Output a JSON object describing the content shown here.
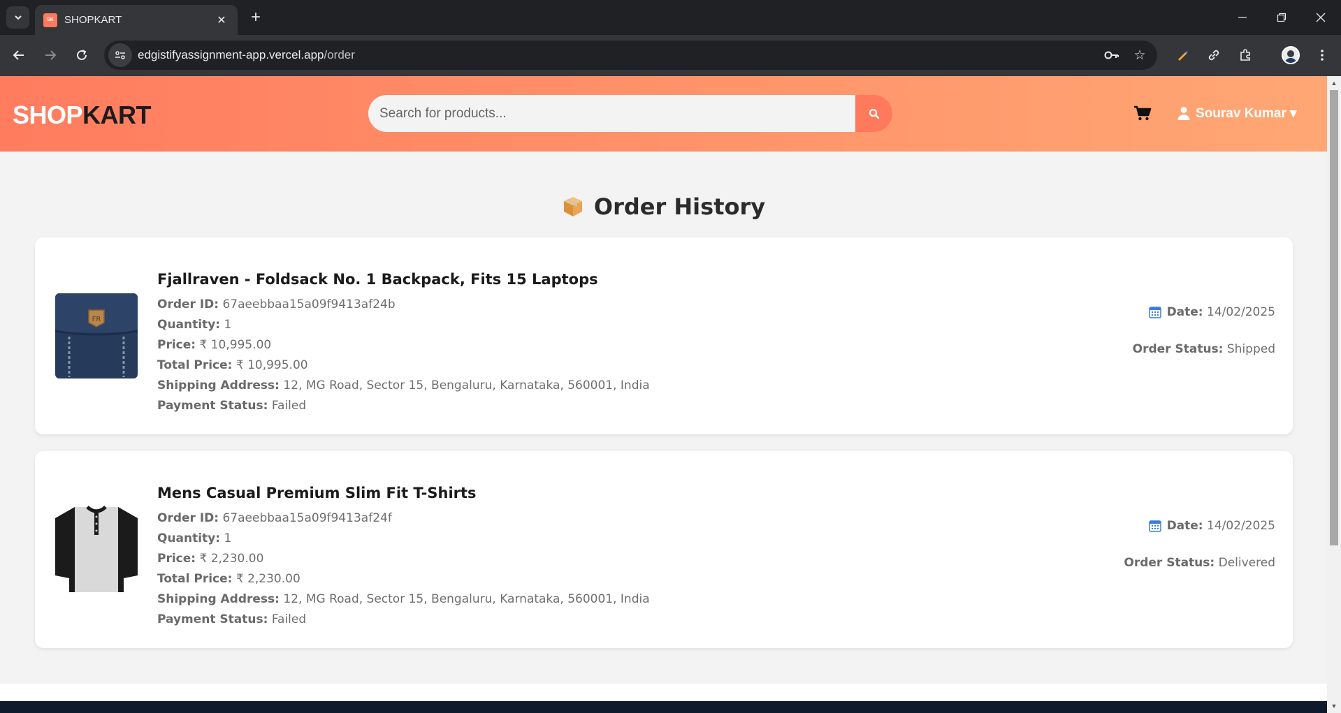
{
  "browser": {
    "tab_title": "SHOPKART",
    "favicon_label": "SK",
    "url_host": "edgistifyassignment-app.vercel.app",
    "url_path": "/order"
  },
  "header": {
    "logo_part1": "SHOP",
    "logo_part2": "KART",
    "search_placeholder": "Search for products...",
    "user_name": "Sourav Kumar ▾"
  },
  "page": {
    "title": "Order History"
  },
  "orders": [
    {
      "product_name": "Fjallraven - Foldsack No. 1 Backpack, Fits 15 Laptops",
      "order_id_label": "Order ID:",
      "order_id": "67aeebbaa15a09f9413af24b",
      "quantity_label": "Quantity:",
      "quantity": "1",
      "price_label": "Price:",
      "price": "₹ 10,995.00",
      "total_label": "Total Price:",
      "total": "₹ 10,995.00",
      "address_label": "Shipping Address:",
      "address": "12, MG Road, Sector 15, Bengaluru, Karnataka, 560001, India",
      "payment_label": "Payment Status:",
      "payment": "Failed",
      "date_label": "Date:",
      "date": "14/02/2025",
      "status_label": "Order Status:",
      "status": "Shipped"
    },
    {
      "product_name": "Mens Casual Premium Slim Fit T-Shirts",
      "order_id_label": "Order ID:",
      "order_id": "67aeebbaa15a09f9413af24f",
      "quantity_label": "Quantity:",
      "quantity": "1",
      "price_label": "Price:",
      "price": "₹ 2,230.00",
      "total_label": "Total Price:",
      "total": "₹ 2,230.00",
      "address_label": "Shipping Address:",
      "address": "12, MG Road, Sector 15, Bengaluru, Karnataka, 560001, India",
      "payment_label": "Payment Status:",
      "payment": "Failed",
      "date_label": "Date:",
      "date": "14/02/2025",
      "status_label": "Order Status:",
      "status": "Delivered"
    }
  ],
  "colors": {
    "header_gradient_start": "#ff7c5f",
    "header_gradient_end": "#ffa774",
    "accent": "#ff7a5c",
    "page_bg": "#f3f3f3",
    "footer": "#0f1a2c"
  },
  "icons": {
    "search": "search-icon",
    "cart": "cart-icon",
    "user": "user-icon",
    "package": "package-icon",
    "calendar": "calendar-icon"
  }
}
